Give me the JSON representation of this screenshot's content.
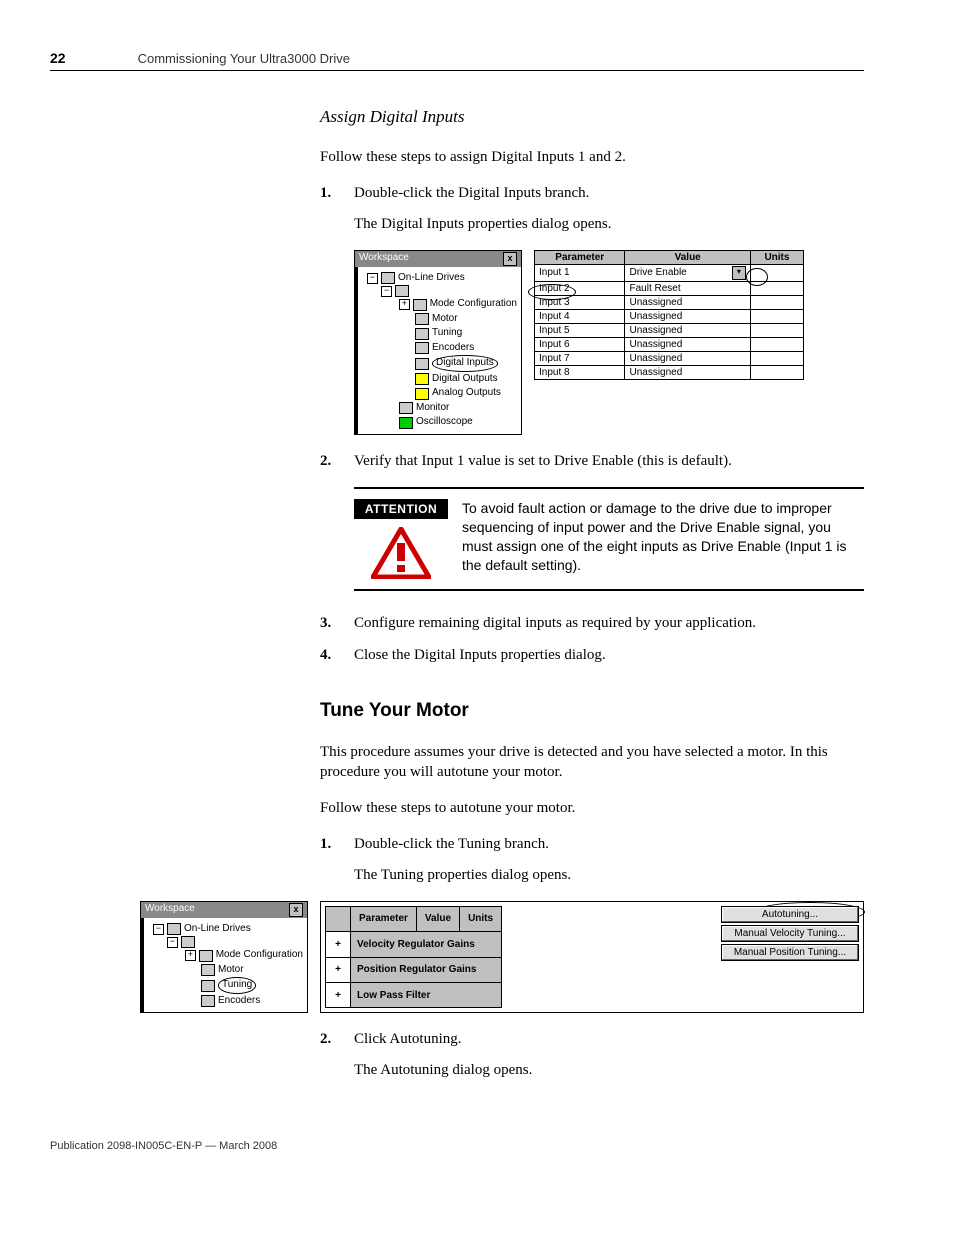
{
  "header": {
    "page_number": "22",
    "running_title": "Commissioning Your Ultra3000 Drive"
  },
  "section1": {
    "heading": "Assign Digital Inputs",
    "intro": "Follow these steps to assign Digital Inputs 1 and 2.",
    "steps": [
      {
        "num": "1.",
        "text": "Double-click the Digital Inputs branch.",
        "sub": "The Digital Inputs properties dialog opens."
      },
      {
        "num": "2.",
        "text": "Verify that Input 1 value is set to Drive Enable (this is default)."
      },
      {
        "num": "3.",
        "text": "Configure remaining digital inputs as required by your application."
      },
      {
        "num": "4.",
        "text": "Close the Digital Inputs properties dialog."
      }
    ]
  },
  "workspace1": {
    "title": "Workspace",
    "tree": {
      "root": "On-Line Drives",
      "items": [
        "Mode Configuration",
        "Motor",
        "Tuning",
        "Encoders",
        "Digital Inputs",
        "Digital Outputs",
        "Analog Outputs",
        "Monitor",
        "Oscilloscope"
      ]
    }
  },
  "param_table": {
    "headers": {
      "param": "Parameter",
      "value": "Value",
      "units": "Units"
    },
    "rows": [
      {
        "param": "Input 1",
        "value": "Drive Enable"
      },
      {
        "param": "Input 2",
        "value": "Fault Reset"
      },
      {
        "param": "Input 3",
        "value": "Unassigned"
      },
      {
        "param": "Input 4",
        "value": "Unassigned"
      },
      {
        "param": "Input 5",
        "value": "Unassigned"
      },
      {
        "param": "Input 6",
        "value": "Unassigned"
      },
      {
        "param": "Input 7",
        "value": "Unassigned"
      },
      {
        "param": "Input 8",
        "value": "Unassigned"
      }
    ]
  },
  "attention": {
    "label": "ATTENTION",
    "text": "To avoid fault action or damage to the drive due to improper sequencing of input power and the Drive Enable signal, you must assign one of the eight inputs as Drive Enable (Input 1 is the default setting)."
  },
  "section2": {
    "heading": "Tune Your Motor",
    "intro": "This procedure assumes your drive is detected and you have selected a motor. In this procedure you will autotune your motor.",
    "follow": "Follow these steps to autotune your motor.",
    "steps": [
      {
        "num": "1.",
        "text": "Double-click the Tuning branch.",
        "sub": "The Tuning properties dialog opens."
      },
      {
        "num": "2.",
        "text": "Click Autotuning.",
        "sub": "The Autotuning dialog opens."
      }
    ]
  },
  "workspace2": {
    "title": "Workspace",
    "tree": {
      "root": "On-Line Drives",
      "items": [
        "Mode Configuration",
        "Motor",
        "Tuning",
        "Encoders"
      ]
    }
  },
  "tuning_table": {
    "headers": {
      "param": "Parameter",
      "value": "Value",
      "units": "Units"
    },
    "rows": [
      {
        "param": "Velocity Regulator Gains"
      },
      {
        "param": "Position Regulator Gains"
      },
      {
        "param": "Low Pass Filter"
      }
    ]
  },
  "tuning_buttons": {
    "auto": "Autotuning...",
    "manual_vel": "Manual Velocity Tuning...",
    "manual_pos": "Manual Position Tuning..."
  },
  "footer": {
    "pub": "Publication 2098-IN005C-EN-P — March 2008"
  },
  "glyphs": {
    "minus": "−",
    "plus": "+",
    "x": "x",
    "down": "▾"
  }
}
